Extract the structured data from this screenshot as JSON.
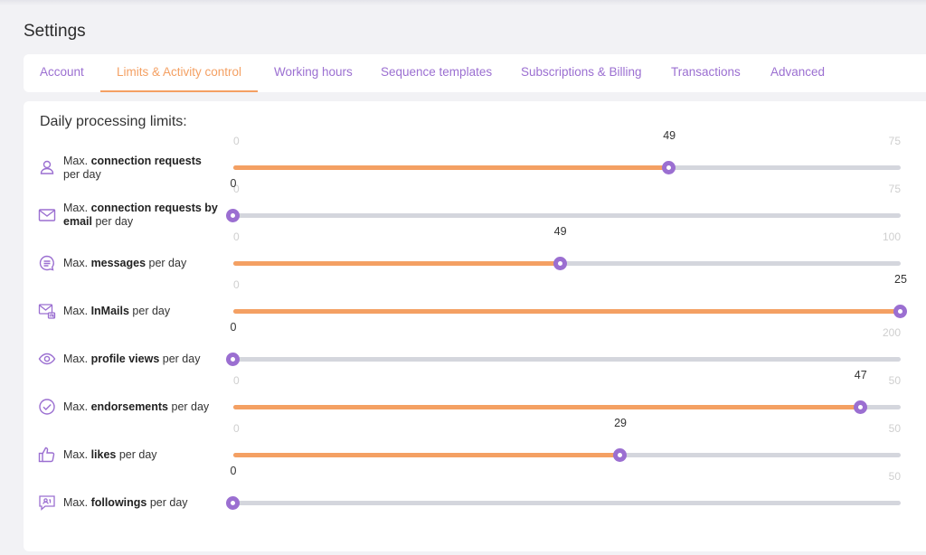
{
  "page": {
    "title": "Settings"
  },
  "tabs": [
    {
      "label": "Account",
      "active": false
    },
    {
      "label": "Limits & Activity control",
      "active": true
    },
    {
      "label": "Working hours",
      "active": false
    },
    {
      "label": "Sequence templates",
      "active": false
    },
    {
      "label": "Subscriptions & Billing",
      "active": false
    },
    {
      "label": "Transactions",
      "active": false
    },
    {
      "label": "Advanced",
      "active": false
    }
  ],
  "section": {
    "title": "Daily processing limits:"
  },
  "colors": {
    "accent_orange": "#f4a063",
    "accent_purple": "#9b6fd1",
    "track": "#d4d6dd"
  },
  "limits": [
    {
      "icon": "user-icon",
      "prefix": "Max. ",
      "bold": "connection requests",
      "suffix": " per day",
      "min": "0",
      "max": "75",
      "value": "49"
    },
    {
      "icon": "envelope-icon",
      "prefix": "Max. ",
      "bold": "connection requests by email",
      "suffix": " per day",
      "min": "0",
      "max": "75",
      "value": "0"
    },
    {
      "icon": "chat-bubble-icon",
      "prefix": "Max. ",
      "bold": "messages",
      "suffix": " per day",
      "min": "0",
      "max": "100",
      "value": "49"
    },
    {
      "icon": "inmail-icon",
      "prefix": "Max. ",
      "bold": "InMails",
      "suffix": " per day",
      "min": "0",
      "max": "25",
      "value": "25"
    },
    {
      "icon": "eye-icon",
      "prefix": "Max. ",
      "bold": "profile views",
      "suffix": " per day",
      "min": "0",
      "max": "200",
      "value": "0"
    },
    {
      "icon": "check-circle-icon",
      "prefix": "Max. ",
      "bold": "endorsements",
      "suffix": " per day",
      "min": "0",
      "max": "50",
      "value": "47"
    },
    {
      "icon": "thumbs-up-icon",
      "prefix": "Max. ",
      "bold": "likes",
      "suffix": " per day",
      "min": "0",
      "max": "50",
      "value": "29"
    },
    {
      "icon": "follow-icon",
      "prefix": "Max. ",
      "bold": "followings",
      "suffix": " per day",
      "min": "0",
      "max": "50",
      "value": "0"
    }
  ]
}
